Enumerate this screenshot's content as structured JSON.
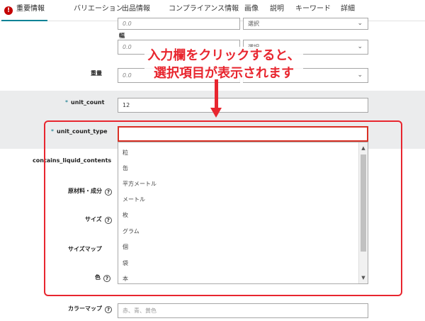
{
  "tabs": [
    {
      "label": "重要情報",
      "active": true
    },
    {
      "label": "バリエーション"
    },
    {
      "label": "出品情報"
    },
    {
      "label": "コンプライアンス情報"
    },
    {
      "label": "画像"
    },
    {
      "label": "説明"
    },
    {
      "label": "キーワード"
    },
    {
      "label": "詳細"
    }
  ],
  "dims": {
    "row1": {
      "value": "0.0",
      "select": "選択"
    },
    "width_label": "幅",
    "row2": {
      "value": "0.0",
      "select": "選択"
    }
  },
  "weight": {
    "label": "重量",
    "value": "0.0"
  },
  "unit_count": {
    "label": "unit_count",
    "value": "12"
  },
  "unit_count_type": {
    "label": "unit_count_type",
    "value": ""
  },
  "fields": {
    "contains_liquid": "contains_liquid_contents",
    "material": "原材料・成分",
    "size": "サイズ",
    "size_map": "サイズマップ",
    "color": "色",
    "color_map": "カラーマップ"
  },
  "color_map_placeholder": "赤、青、黄色",
  "dropdown_options": [
    "粒",
    "缶",
    "平方メートル",
    "メートル",
    "枚",
    "グラム",
    "個",
    "袋",
    "本"
  ],
  "annotation": {
    "line1": "入力欄をクリックすると、",
    "line2": "選択項目が表示されます"
  },
  "colors": {
    "accent": "#008296",
    "annotation_red": "#e8262f",
    "error_red": "#c40000"
  }
}
